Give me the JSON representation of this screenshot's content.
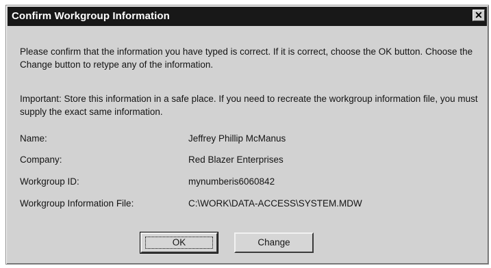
{
  "dialog": {
    "title": "Confirm Workgroup Information",
    "close_glyph": "✕",
    "message": "Please confirm that the information you have typed is correct. If it is correct, choose the OK button. Choose the Change button to retype any of the information.",
    "important": "Important: Store this information in a safe place. If you need to recreate the workgroup information file, you must supply the exact same information.",
    "fields": [
      {
        "label": "Name:",
        "value": "Jeffrey Phillip McManus"
      },
      {
        "label": "Company:",
        "value": "Red Blazer Enterprises"
      },
      {
        "label": "Workgroup ID:",
        "value": "mynumberis6060842"
      },
      {
        "label": "Workgroup Information File:",
        "value": "C:\\WORK\\DATA-ACCESS\\SYSTEM.MDW"
      }
    ],
    "buttons": {
      "ok_label": "OK",
      "change_label": "Change"
    }
  }
}
